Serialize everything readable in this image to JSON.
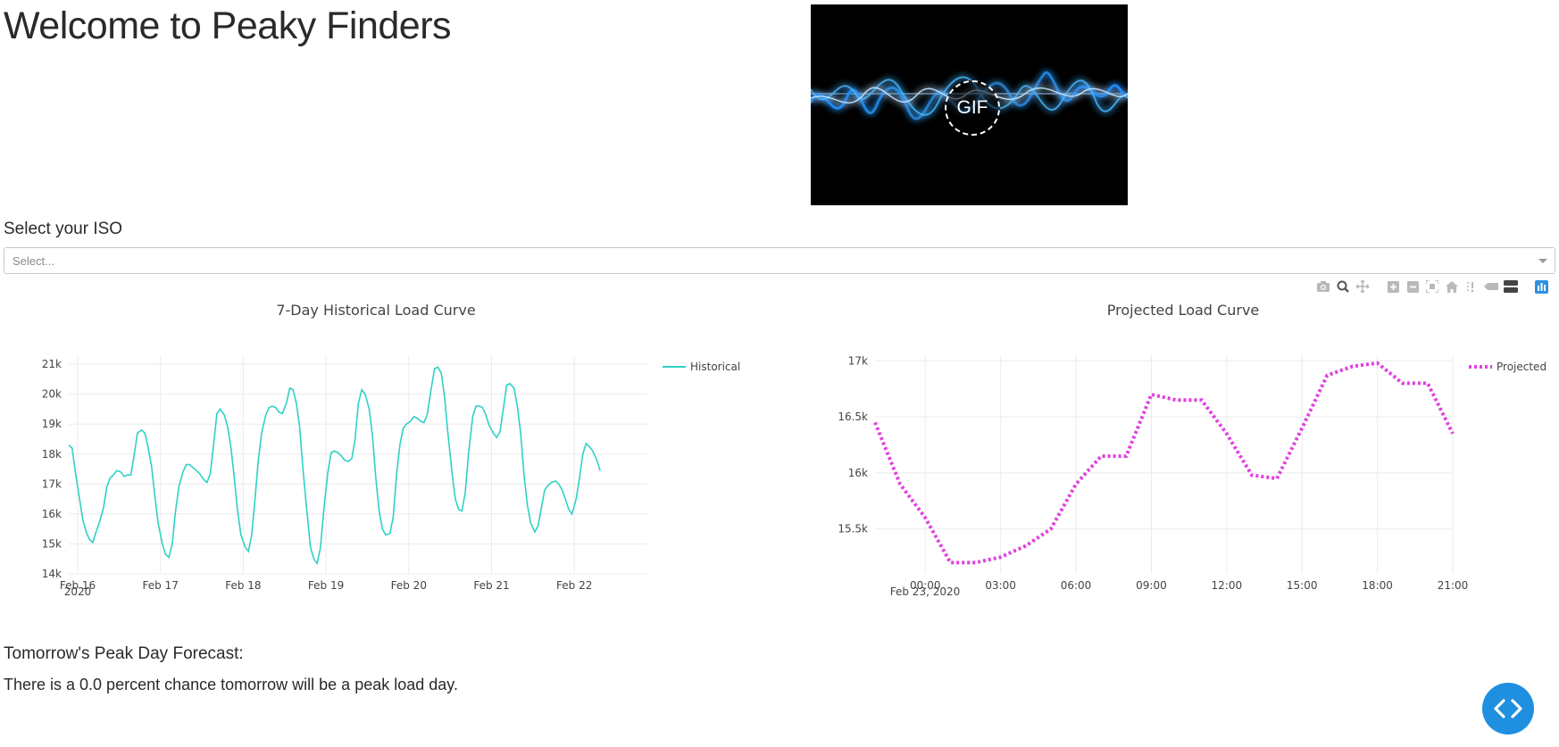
{
  "title": "Welcome to Peaky Finders",
  "gif_label": "GIF",
  "iso": {
    "label": "Select your ISO",
    "placeholder": "Select..."
  },
  "modebar_icons": [
    "camera-icon",
    "zoom-icon",
    "pan-icon",
    "zoom-in-icon",
    "zoom-out-icon",
    "autoscale-icon",
    "reset-axes-icon",
    "spike-lines-icon",
    "hover-closest-icon",
    "hover-compare-icon",
    "plotly-logo-icon"
  ],
  "forecast": {
    "heading": "Tomorrow's Peak Day Forecast:",
    "text": "There is a 0.0 percent chance tomorrow will be a peak load day."
  },
  "chart_data": [
    {
      "type": "line",
      "title": "7-Day Historical Load Curve",
      "x_tick_labels": [
        "Feb 16",
        "Feb 17",
        "Feb 18",
        "Feb 19",
        "Feb 20",
        "Feb 21",
        "Feb 22"
      ],
      "x_tick_sublabel": "2020",
      "x_range_days": [
        0,
        6.88
      ],
      "y_tick_labels": [
        "14k",
        "15k",
        "16k",
        "17k",
        "18k",
        "19k",
        "20k",
        "21k"
      ],
      "ylim": [
        14000,
        21300
      ],
      "grid": true,
      "legend_position": "top-right",
      "color": "#2fd1c7",
      "series": [
        {
          "name": "Historical",
          "points": [
            [
              0.0,
              18300
            ],
            [
              0.04,
              18200
            ],
            [
              0.08,
              17400
            ],
            [
              0.13,
              16500
            ],
            [
              0.17,
              15800
            ],
            [
              0.21,
              15400
            ],
            [
              0.25,
              15150
            ],
            [
              0.29,
              15050
            ],
            [
              0.33,
              15400
            ],
            [
              0.38,
              15800
            ],
            [
              0.42,
              16200
            ],
            [
              0.46,
              16900
            ],
            [
              0.5,
              17200
            ],
            [
              0.54,
              17300
            ],
            [
              0.58,
              17450
            ],
            [
              0.63,
              17400
            ],
            [
              0.67,
              17250
            ],
            [
              0.71,
              17300
            ],
            [
              0.75,
              17300
            ],
            [
              0.79,
              17950
            ],
            [
              0.83,
              18700
            ],
            [
              0.88,
              18800
            ],
            [
              0.92,
              18700
            ],
            [
              0.96,
              18200
            ],
            [
              1.0,
              17600
            ],
            [
              1.04,
              16600
            ],
            [
              1.08,
              15700
            ],
            [
              1.13,
              15000
            ],
            [
              1.17,
              14650
            ],
            [
              1.21,
              14550
            ],
            [
              1.25,
              15000
            ],
            [
              1.29,
              16100
            ],
            [
              1.33,
              16900
            ],
            [
              1.38,
              17400
            ],
            [
              1.42,
              17650
            ],
            [
              1.46,
              17650
            ],
            [
              1.5,
              17550
            ],
            [
              1.54,
              17450
            ],
            [
              1.58,
              17350
            ],
            [
              1.63,
              17150
            ],
            [
              1.67,
              17050
            ],
            [
              1.71,
              17350
            ],
            [
              1.75,
              18300
            ],
            [
              1.79,
              19350
            ],
            [
              1.83,
              19500
            ],
            [
              1.88,
              19300
            ],
            [
              1.92,
              18900
            ],
            [
              1.96,
              18200
            ],
            [
              2.0,
              17200
            ],
            [
              2.04,
              16100
            ],
            [
              2.08,
              15300
            ],
            [
              2.13,
              14900
            ],
            [
              2.17,
              14750
            ],
            [
              2.21,
              15300
            ],
            [
              2.25,
              16500
            ],
            [
              2.29,
              17800
            ],
            [
              2.33,
              18700
            ],
            [
              2.38,
              19300
            ],
            [
              2.42,
              19550
            ],
            [
              2.46,
              19600
            ],
            [
              2.5,
              19550
            ],
            [
              2.54,
              19400
            ],
            [
              2.58,
              19350
            ],
            [
              2.63,
              19700
            ],
            [
              2.67,
              20200
            ],
            [
              2.71,
              20150
            ],
            [
              2.75,
              19700
            ],
            [
              2.79,
              18900
            ],
            [
              2.83,
              17500
            ],
            [
              2.88,
              16000
            ],
            [
              2.92,
              14900
            ],
            [
              2.96,
              14500
            ],
            [
              3.0,
              14350
            ],
            [
              3.04,
              14850
            ],
            [
              3.08,
              16100
            ],
            [
              3.13,
              17400
            ],
            [
              3.17,
              18050
            ],
            [
              3.21,
              18100
            ],
            [
              3.25,
              18050
            ],
            [
              3.29,
              17950
            ],
            [
              3.33,
              17800
            ],
            [
              3.38,
              17750
            ],
            [
              3.42,
              17850
            ],
            [
              3.46,
              18500
            ],
            [
              3.5,
              19700
            ],
            [
              3.54,
              20150
            ],
            [
              3.58,
              20000
            ],
            [
              3.63,
              19500
            ],
            [
              3.67,
              18600
            ],
            [
              3.71,
              17200
            ],
            [
              3.75,
              16100
            ],
            [
              3.79,
              15500
            ],
            [
              3.83,
              15300
            ],
            [
              3.88,
              15350
            ],
            [
              3.92,
              15900
            ],
            [
              3.96,
              17300
            ],
            [
              4.0,
              18300
            ],
            [
              4.04,
              18850
            ],
            [
              4.08,
              19000
            ],
            [
              4.13,
              19100
            ],
            [
              4.17,
              19250
            ],
            [
              4.21,
              19200
            ],
            [
              4.25,
              19100
            ],
            [
              4.29,
              19050
            ],
            [
              4.33,
              19300
            ],
            [
              4.38,
              20200
            ],
            [
              4.42,
              20850
            ],
            [
              4.46,
              20900
            ],
            [
              4.5,
              20700
            ],
            [
              4.54,
              19900
            ],
            [
              4.58,
              18700
            ],
            [
              4.63,
              17400
            ],
            [
              4.67,
              16500
            ],
            [
              4.71,
              16150
            ],
            [
              4.75,
              16100
            ],
            [
              4.79,
              16700
            ],
            [
              4.83,
              18000
            ],
            [
              4.88,
              19250
            ],
            [
              4.92,
              19600
            ],
            [
              4.96,
              19600
            ],
            [
              5.0,
              19550
            ],
            [
              5.04,
              19300
            ],
            [
              5.08,
              18950
            ],
            [
              5.13,
              18700
            ],
            [
              5.17,
              18550
            ],
            [
              5.21,
              18750
            ],
            [
              5.25,
              19500
            ],
            [
              5.29,
              20300
            ],
            [
              5.33,
              20350
            ],
            [
              5.38,
              20200
            ],
            [
              5.42,
              19600
            ],
            [
              5.46,
              18700
            ],
            [
              5.5,
              17300
            ],
            [
              5.54,
              16300
            ],
            [
              5.58,
              15700
            ],
            [
              5.63,
              15400
            ],
            [
              5.67,
              15600
            ],
            [
              5.71,
              16200
            ],
            [
              5.75,
              16800
            ],
            [
              5.79,
              16950
            ],
            [
              5.83,
              17050
            ],
            [
              5.88,
              17100
            ],
            [
              5.92,
              17000
            ],
            [
              5.96,
              16800
            ],
            [
              6.0,
              16500
            ],
            [
              6.04,
              16150
            ],
            [
              6.08,
              16000
            ],
            [
              6.13,
              16500
            ],
            [
              6.17,
              17200
            ],
            [
              6.21,
              18000
            ],
            [
              6.25,
              18350
            ],
            [
              6.29,
              18250
            ],
            [
              6.33,
              18100
            ],
            [
              6.38,
              17800
            ],
            [
              6.42,
              17450
            ]
          ]
        }
      ]
    },
    {
      "type": "line",
      "title": "Projected Load Curve",
      "x_tick_labels": [
        "00:00",
        "03:00",
        "06:00",
        "09:00",
        "12:00",
        "15:00",
        "18:00",
        "21:00"
      ],
      "x_tick_sublabel": "Feb 23, 2020",
      "x_range_hours": [
        -2,
        21
      ],
      "y_tick_labels": [
        "15.5k",
        "16k",
        "16.5k",
        "17k"
      ],
      "ylim": [
        15100,
        17050
      ],
      "grid": true,
      "legend_position": "top-right",
      "color": "#e040e0",
      "line_style": "dotted",
      "series": [
        {
          "name": "Projected",
          "points": [
            [
              -2,
              16450
            ],
            [
              -1,
              15900
            ],
            [
              0,
              15600
            ],
            [
              1,
              15200
            ],
            [
              2,
              15200
            ],
            [
              3,
              15250
            ],
            [
              4,
              15350
            ],
            [
              5,
              15500
            ],
            [
              6,
              15900
            ],
            [
              7,
              16150
            ],
            [
              8,
              16150
            ],
            [
              9,
              16700
            ],
            [
              10,
              16650
            ],
            [
              11,
              16650
            ],
            [
              12,
              16350
            ],
            [
              13,
              15980
            ],
            [
              14,
              15950
            ],
            [
              15,
              16400
            ],
            [
              16,
              16870
            ],
            [
              17,
              16950
            ],
            [
              18,
              16980
            ],
            [
              19,
              16800
            ],
            [
              20,
              16800
            ],
            [
              21,
              16350
            ]
          ]
        }
      ]
    }
  ]
}
